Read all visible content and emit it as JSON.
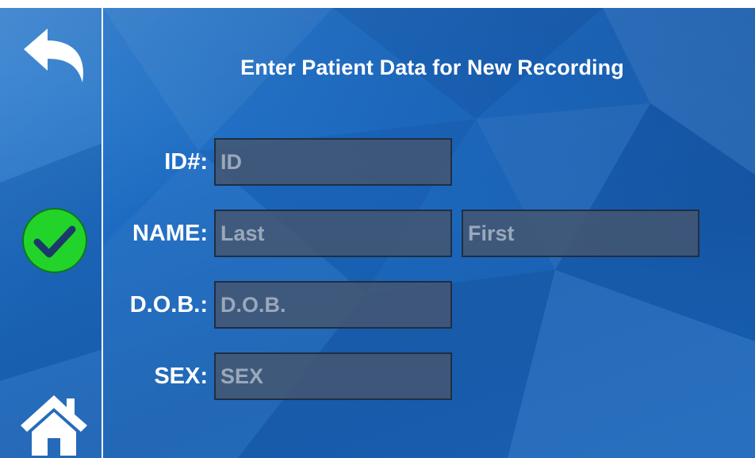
{
  "title": "Enter Patient Data for New Recording",
  "sidebar": {
    "back_icon": "back-arrow-icon",
    "confirm_icon": "checkmark-icon",
    "home_icon": "home-icon",
    "confirm_color": "#22d42a"
  },
  "form": {
    "id": {
      "label": "ID#:",
      "placeholder": "ID",
      "value": ""
    },
    "name": {
      "label": "NAME:",
      "last": {
        "placeholder": "Last",
        "value": ""
      },
      "first": {
        "placeholder": "First",
        "value": ""
      }
    },
    "dob": {
      "label": "D.O.B.:",
      "placeholder": "D.O.B.",
      "value": ""
    },
    "sex": {
      "label": "SEX:",
      "placeholder": "SEX",
      "value": ""
    }
  }
}
